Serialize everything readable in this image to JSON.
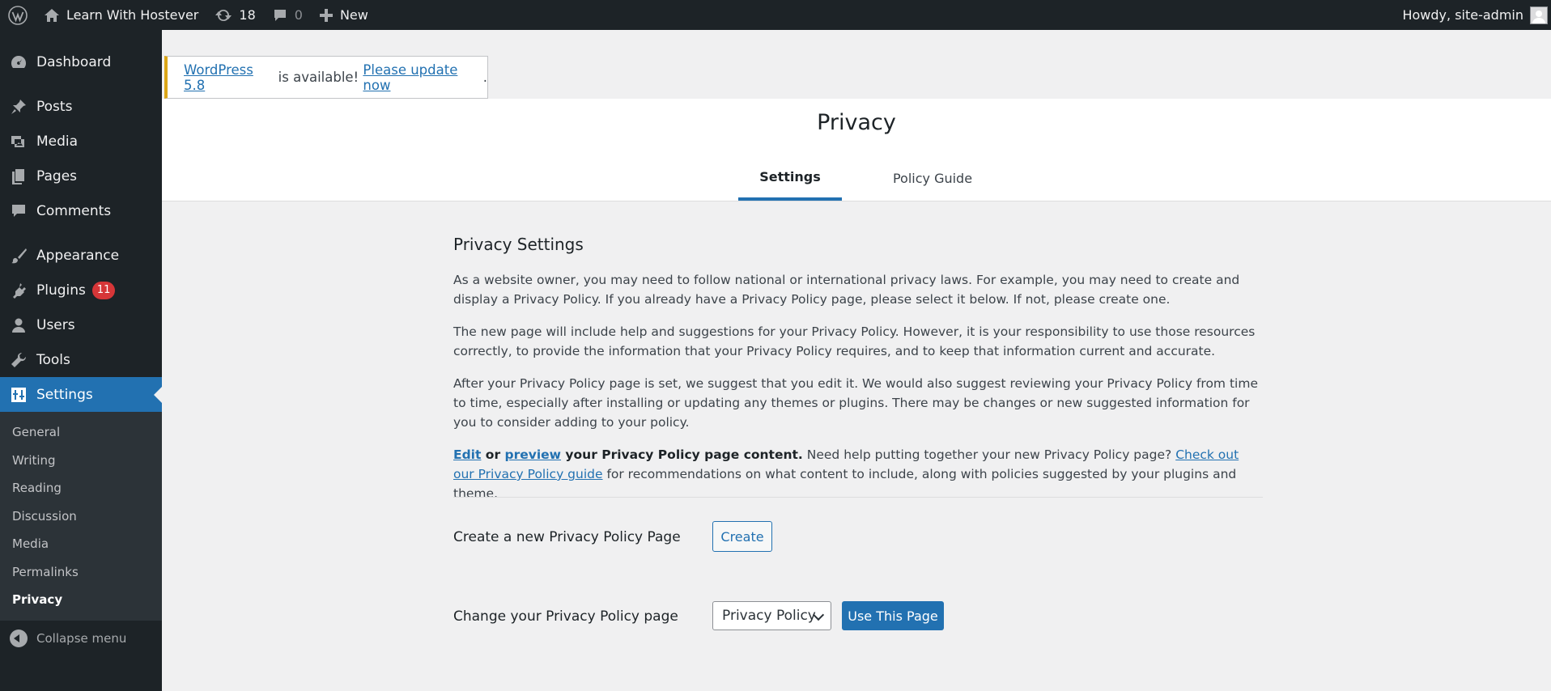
{
  "adminbar": {
    "site_name": "Learn With Hostever",
    "updates_count": "18",
    "comments_count": "0",
    "new_label": "New",
    "howdy": "Howdy, site-admin"
  },
  "sidebar": {
    "items": [
      {
        "label": "Dashboard"
      },
      {
        "label": "Posts"
      },
      {
        "label": "Media"
      },
      {
        "label": "Pages"
      },
      {
        "label": "Comments"
      },
      {
        "label": "Appearance"
      },
      {
        "label": "Plugins",
        "badge": "11"
      },
      {
        "label": "Users"
      },
      {
        "label": "Tools"
      },
      {
        "label": "Settings"
      }
    ],
    "submenu": [
      "General",
      "Writing",
      "Reading",
      "Discussion",
      "Media",
      "Permalinks",
      "Privacy"
    ],
    "collapse_label": "Collapse menu"
  },
  "notice": {
    "version_link": "WordPress 5.8",
    "middle_text": " is available! ",
    "update_link": "Please update now",
    "end": "."
  },
  "header": {
    "title": "Privacy",
    "tabs": [
      "Settings",
      "Policy Guide"
    ]
  },
  "main": {
    "heading": "Privacy Settings",
    "p1": "As a website owner, you may need to follow national or international privacy laws. For example, you may need to create and display a Privacy Policy. If you already have a Privacy Policy page, please select it below. If not, please create one.",
    "p2": "The new page will include help and suggestions for your Privacy Policy. However, it is your responsibility to use those resources correctly, to provide the information that your Privacy Policy requires, and to keep that information current and accurate.",
    "p3": "After your Privacy Policy page is set, we suggest that you edit it. We would also suggest reviewing your Privacy Policy from time to time, especially after installing or updating any themes or plugins. There may be changes or new suggested information for you to consider adding to your policy.",
    "p4": {
      "edit": "Edit",
      "or": " or ",
      "preview": "preview",
      "bold_rest": " your Privacy Policy page content.",
      "text": " Need help putting together your new Privacy Policy page? ",
      "guide_link": "Check out our Privacy Policy guide",
      "tail": " for recommendations on what content to include, along with policies suggested by your plugins and theme."
    },
    "create_label": "Create a new Privacy Policy Page",
    "create_button": "Create",
    "change_label": "Change your Privacy Policy page",
    "select_value": "Privacy Policy",
    "use_button": "Use This Page"
  },
  "colors": {
    "admin_dark": "#1d2327",
    "accent": "#2271b1",
    "notice_warning": "#dba617",
    "badge_red": "#d63638"
  }
}
